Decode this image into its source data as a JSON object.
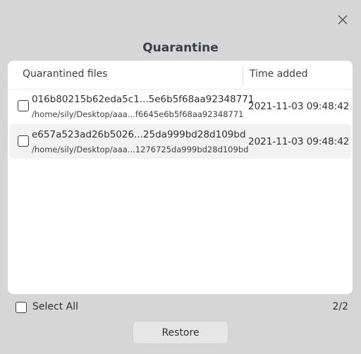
{
  "dialog": {
    "title": "Quarantine",
    "close_icon": "close-icon"
  },
  "table": {
    "columns": [
      "Quarantined files",
      "Time added"
    ],
    "rows": [
      {
        "name": "016b80215b62eda5c1...5e6b5f68aa92348771",
        "path": "/home/sily/Desktop/aaa...f6645e6b5f68aa92348771",
        "time": "2021-11-03 09:48:42",
        "checked": false
      },
      {
        "name": "e657a523ad26b5026...25da999bd28d109bd",
        "path": "/home/sily/Desktop/aaa...1276725da999bd28d109bd",
        "time": "2021-11-03 09:48:42",
        "checked": false
      }
    ]
  },
  "footer": {
    "select_all_label": "Select All",
    "count": "2/2",
    "restore_label": "Restore"
  }
}
